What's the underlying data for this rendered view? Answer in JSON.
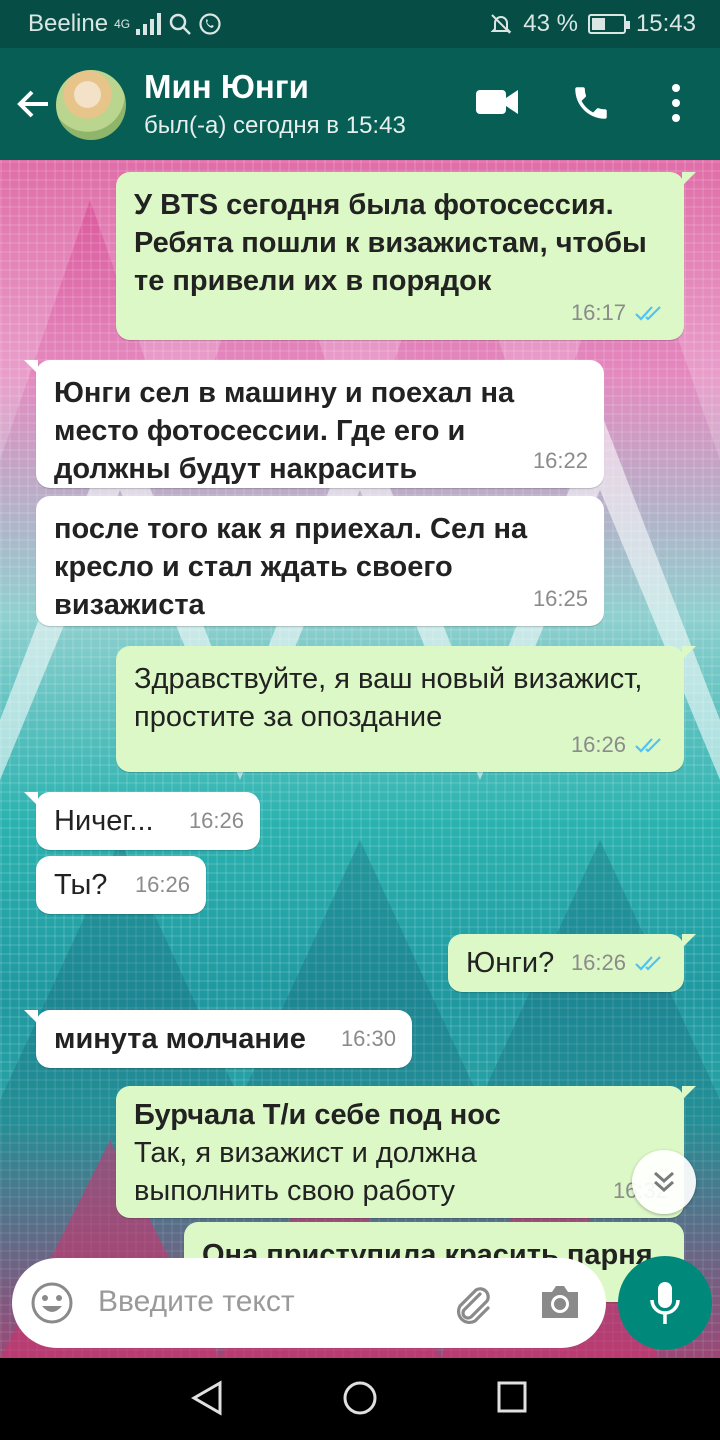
{
  "status_bar": {
    "carrier": "Beeline",
    "network": "4G",
    "battery": "43 %",
    "battery_level": 0.43,
    "time": "15:43"
  },
  "header": {
    "contact_name": "Мин Юнги",
    "last_seen": "был(-а) сегодня в 15:43",
    "icons": [
      "back-arrow-icon",
      "video-call-icon",
      "phone-icon",
      "more-vert-icon"
    ]
  },
  "messages": [
    {
      "dir": "out",
      "bold_text": "У BTS сегодня была фотосессия. Ребята пошли к визажистам, чтобы те привели их в порядок",
      "time": "16:17",
      "read": true
    },
    {
      "dir": "in",
      "bold_text": "Юнги сел в машину и поехал на место фотосессии. Где его и должны будут накрасить",
      "time": "16:22"
    },
    {
      "dir": "in",
      "bold_text": "после того как я приехал. Сел на кресло и стал ждать своего визажиста",
      "time": "16:25"
    },
    {
      "dir": "out",
      "text": "Здравствуйте, я ваш новый визажист, простите за опоздание",
      "time": "16:26",
      "read": true
    },
    {
      "dir": "in",
      "text": "Ничег...",
      "time": "16:26"
    },
    {
      "dir": "in",
      "text": "Ты?",
      "time": "16:26"
    },
    {
      "dir": "out",
      "text": "Юнги?",
      "time": "16:26",
      "read": true
    },
    {
      "dir": "in",
      "bold_text": "минута молчание",
      "time": "16:30"
    },
    {
      "dir": "out",
      "bold_text": "Бурчала Т/и себе под нос",
      "text": "Так, я визажист и должна выполнить свою работу",
      "time": "16:32"
    },
    {
      "dir": "out",
      "bold_text": "Она приступила красить парня",
      "partial": true
    }
  ],
  "input": {
    "placeholder": "Введите текст"
  },
  "colors": {
    "header": "#075e54",
    "status_bar": "#064e45",
    "incoming_bubble": "#ffffff",
    "outgoing_bubble": "#dcf8c6",
    "read_ticks": "#4fc3f7",
    "mic_button": "#00897b"
  }
}
